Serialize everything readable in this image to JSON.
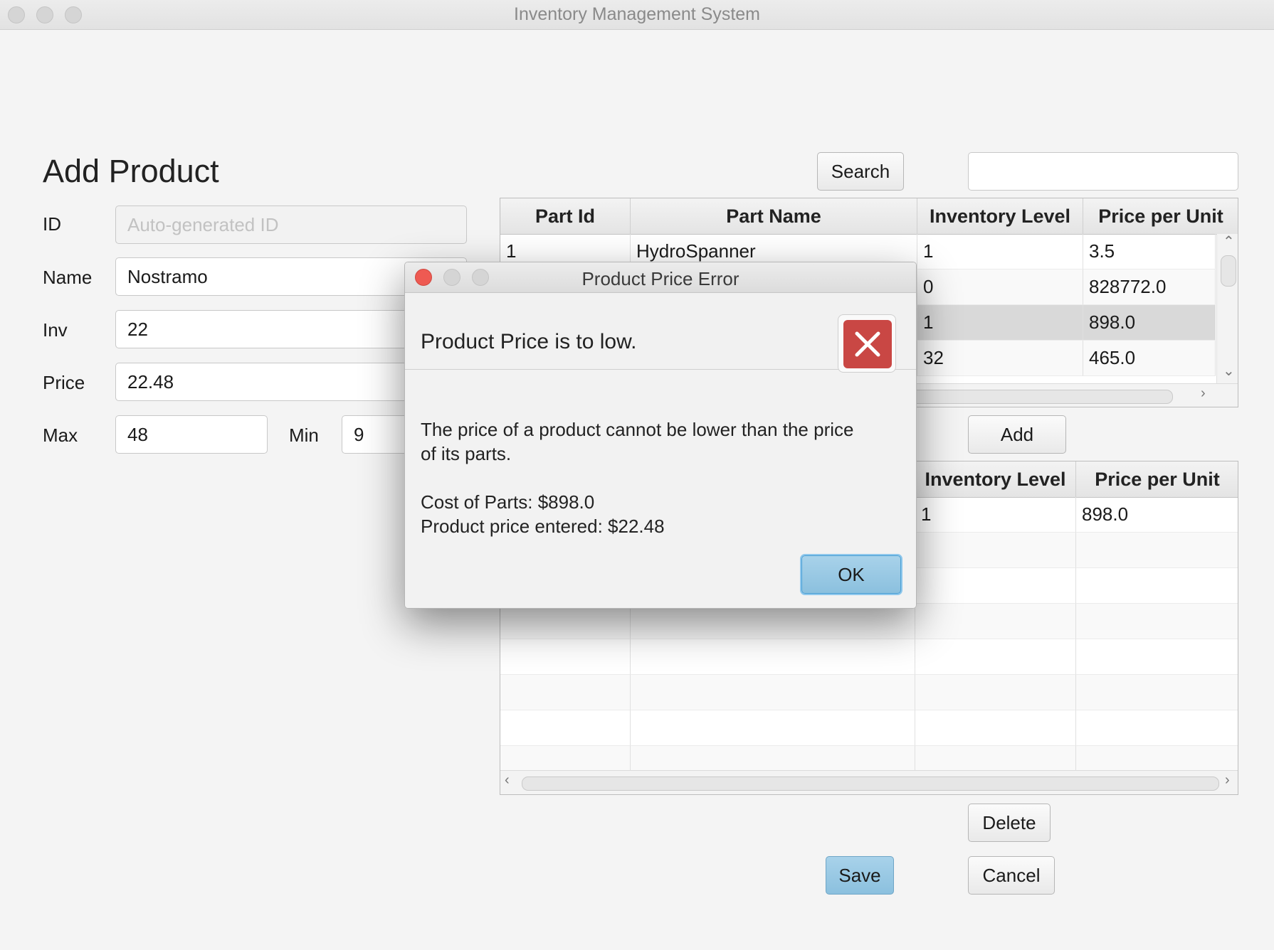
{
  "window": {
    "title": "Inventory Management System"
  },
  "form": {
    "heading": "Add Product",
    "id_label": "ID",
    "id_placeholder": "Auto-generated ID",
    "name_label": "Name",
    "name_value": "Nostramo",
    "inv_label": "Inv",
    "inv_value": "22",
    "price_label": "Price",
    "price_value": "22.48",
    "max_label": "Max",
    "max_value": "48",
    "min_label": "Min",
    "min_value": "9"
  },
  "search": {
    "button_label": "Search",
    "value": ""
  },
  "parts_table": {
    "columns": [
      "Part Id",
      "Part Name",
      "Inventory Level",
      "Price per Unit"
    ],
    "rows": [
      [
        "1",
        "HydroSpanner",
        "1",
        "3.5"
      ],
      [
        "",
        "",
        "0",
        "828772.0"
      ],
      [
        "",
        "",
        "1",
        "898.0"
      ],
      [
        "",
        "",
        "32",
        "465.0"
      ]
    ],
    "selected_row": 2
  },
  "add_button": "Add",
  "product_parts_table": {
    "columns": [
      "Inventory Level",
      "Price per Unit"
    ],
    "rows": [
      [
        "1",
        "898.0"
      ]
    ]
  },
  "delete_button": "Delete",
  "save_button": "Save",
  "cancel_button": "Cancel",
  "dialog": {
    "title": "Product Price Error",
    "header": "Product Price is to low.",
    "body_line1": "The price of a product cannot be lower than the price",
    "body_line2": "of its parts.",
    "cost_line": "Cost of Parts: $898.0",
    "price_line": "Product price entered: $22.48",
    "ok_label": "OK",
    "icon": "error-x-icon",
    "icon_color": "#c94744"
  }
}
